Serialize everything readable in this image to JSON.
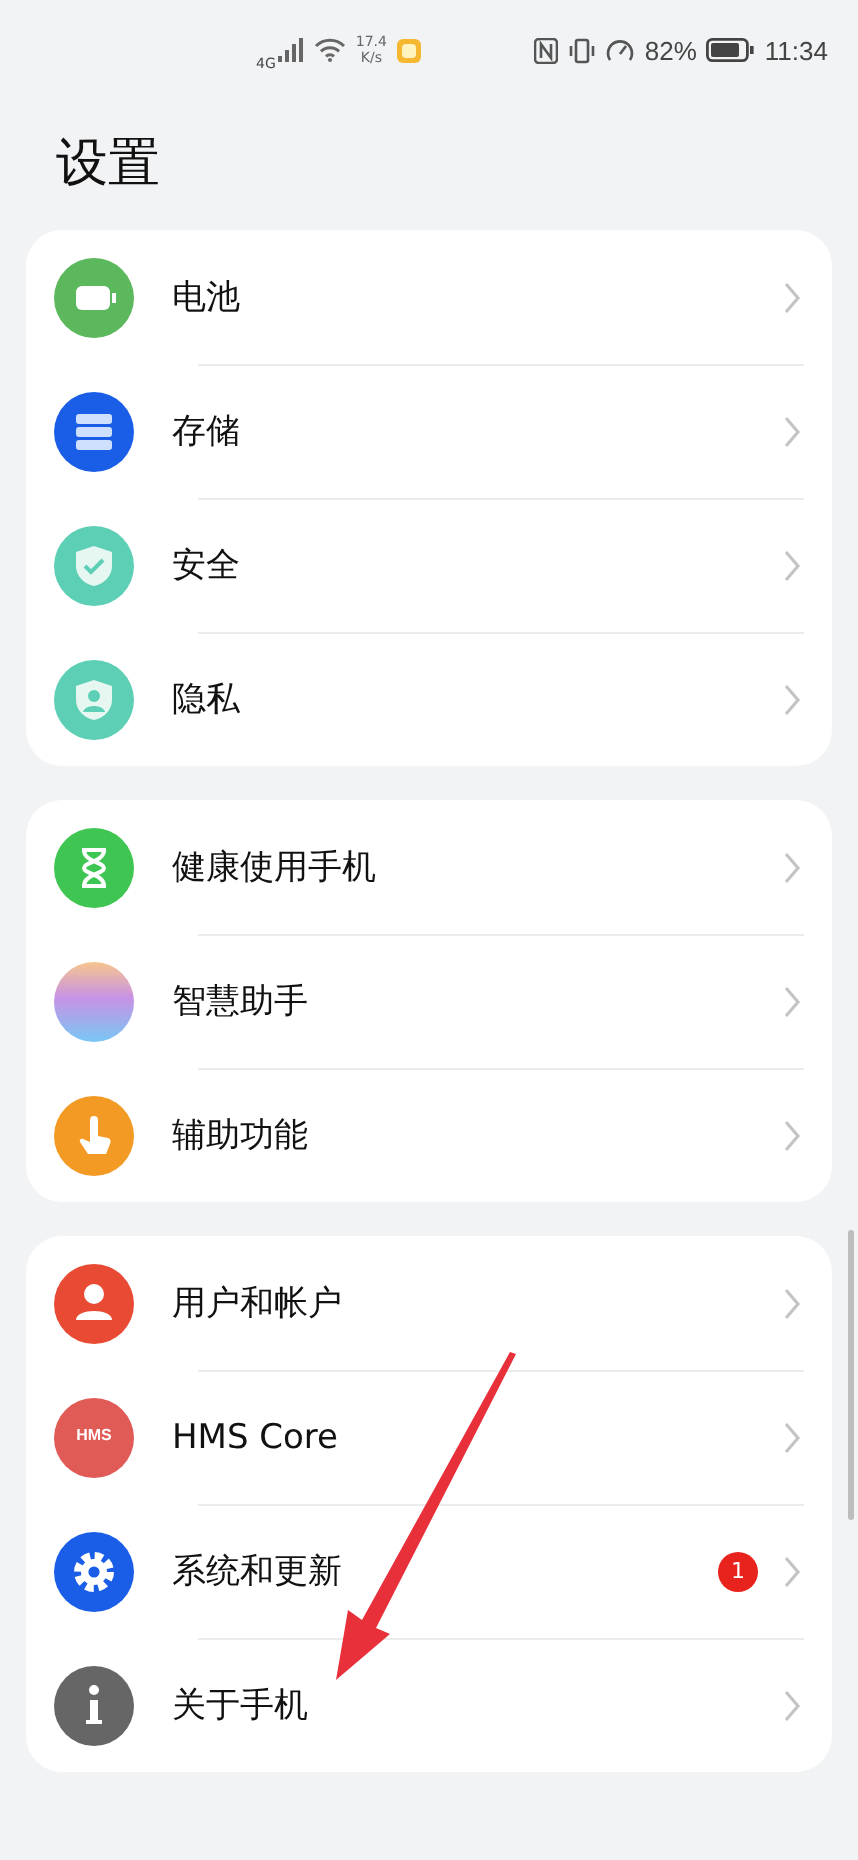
{
  "status_bar": {
    "network": "4G",
    "speed_value": "17.4",
    "speed_unit": "K/s",
    "battery": "82%",
    "time": "11:34"
  },
  "title": "设置",
  "groups": [
    {
      "items": [
        {
          "kind": "battery",
          "color": "#5cb85c",
          "label": "电池"
        },
        {
          "kind": "storage",
          "color": "#1a5ee8",
          "label": "存储"
        },
        {
          "kind": "security",
          "color": "#5ccfb5",
          "label": "安全"
        },
        {
          "kind": "privacy",
          "color": "#5ccfb5",
          "label": "隐私"
        }
      ]
    },
    {
      "items": [
        {
          "kind": "hourglass",
          "color": "#3fc552",
          "label": "健康使用手机"
        },
        {
          "kind": "assistant",
          "color": "#c792e6",
          "label": "智慧助手"
        },
        {
          "kind": "accessibility",
          "color": "#f39a25",
          "label": "辅助功能"
        }
      ]
    },
    {
      "items": [
        {
          "kind": "account",
          "color": "#e84a33",
          "label": "用户和帐户"
        },
        {
          "kind": "hms",
          "color": "#e05a56",
          "icon_text": "HMS",
          "label": "HMS Core"
        },
        {
          "kind": "system",
          "color": "#1a5ee8",
          "label": "系统和更新",
          "badge": "1"
        },
        {
          "kind": "about",
          "color": "#666666",
          "label": "关于手机"
        }
      ]
    }
  ]
}
